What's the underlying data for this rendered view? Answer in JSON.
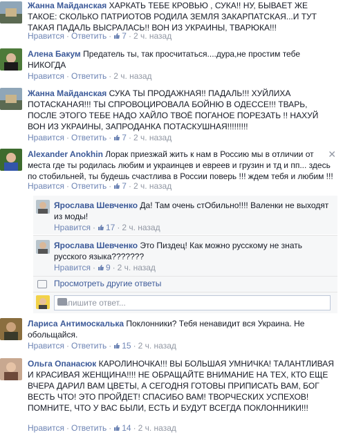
{
  "ui": {
    "like": "Нравится",
    "reply": "Ответить",
    "sep": "·",
    "see_more_replies": "Просмотреть другие ответы",
    "reply_placeholder": "Напишите ответ...",
    "close": "✕"
  },
  "comments": [
    {
      "author": "Жанна Майданская",
      "text": "ХАРКАТЬ ТЕБЕ КРОВЬЮ , СУКА!! НУ, БЫВАЕТ ЖЕ ТАКОЕ: СКОЛЬКО ПАТРИОТОВ РОДИЛА ЗЕМЛЯ ЗАКАРПАТСКАЯ...И ТУТ ТАКАЯ ПАДАЛЬ ВЫСРАЛАСЬ!! ВОН ИЗ УКРАИНЫ, ТВАРЮКА!!!",
      "likes": "7",
      "time": "2 ч. назад"
    },
    {
      "author": "Алена Бакум",
      "text": "Предатель ты, так просчитаться....дура,не простим тебе НИКОГДА",
      "time": "2 ч. назад"
    },
    {
      "author": "Жанна Майданская",
      "text": "СУКА ТЫ ПРОДАЖНАЯ!! ПАДАЛЬ!!! ХУЙЛИХА ПОТАСКАНАЯ!!! ТЫ СПРОВОЦИРОВАЛА БОЙНЮ В ОДЕССЕ!!! ТВАРЬ, ПОСЛЕ ЭТОГО ТЕБЕ НАДО ХАЙЛО ТВОЁ ПОГАНОЕ ПОРЕЗАТЬ !! НАХУЙ ВОН ИЗ УКРАИНЫ, ЗАПРОДАНКА ПОТАСКУШНАЯ!!!!!!!!!",
      "likes": "7",
      "time": "2 ч. назад"
    },
    {
      "author": "Alexander Anokhin",
      "text": "Лорак приезжай жить к нам в Россию мы в отличии от места где ты родилась любим и украинцев и евреев и грузин и тд и пп... здесь по стобильней, ты будешь счастлива в России поверь !!! ждем тебя и любим !!!",
      "likes": "7",
      "time": "2 ч. назад"
    },
    {
      "author": "Лариса Антимоскалька",
      "text": "Поклонники? Тебя ненавидит вся Украина. Не обольщайся.",
      "likes": "15",
      "time": "2 ч. назад"
    },
    {
      "author": "Ольга Опанасюк",
      "text": "КАРОЛИНОЧКА!!! ВЫ БОЛЬШАЯ УМНИЧКА! ТАЛАНТЛИВАЯ И КРАСИВАЯ ЖЕНЩИНА!!!! НЕ ОБРАЩАЙТЕ ВНИМАНИЕ НА ТЕХ, КТО ЕЩЕ ВЧЕРА ДАРИЛ ВАМ ЦВЕТЫ, А СЕГОДНЯ ГОТОВЫ ПРИПИСАТЬ ВАМ, БОГ ВЕСТЬ ЧТО! ЭТО ПРОЙДЕТ! СПАСИБО ВАМ! ТВОРЧЕСКИХ УСПЕХОВ! ПОМНИТЕ, ЧТО У ВАС БЫЛИ, ЕСТЬ И БУДУТ ВСЕГДА ПОКЛОННИКИ!!!",
      "likes": "14",
      "time": "2 ч. назад"
    }
  ],
  "replies": [
    {
      "author": "Ярослава Шевченко",
      "text": "Да! Там очень стОбильно!!!! Валенки не выходят из моды!",
      "likes": "17",
      "time": "2 ч. назад"
    },
    {
      "author": "Ярослава Шевченко",
      "text": "Это Пиздец! Как можно русскому не знать русского языка???????",
      "likes": "9",
      "time": "2 ч. назад"
    }
  ]
}
